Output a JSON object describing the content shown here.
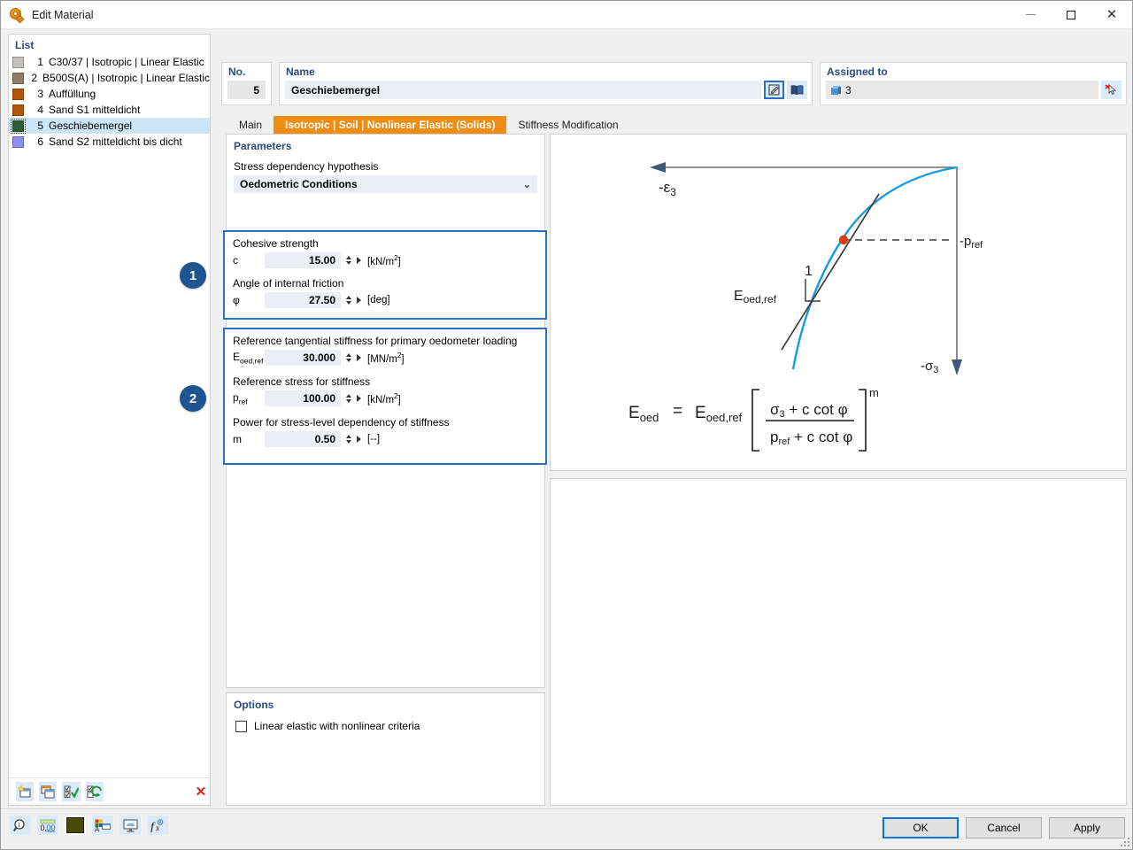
{
  "window": {
    "title": "Edit Material",
    "icon": "material-icon",
    "minimize": "–",
    "maximize": "□",
    "close": "✕"
  },
  "list": {
    "title": "List",
    "items": [
      {
        "num": "1",
        "label": "C30/37 | Isotropic | Linear Elastic",
        "color": "#c3c0bd",
        "selected": false
      },
      {
        "num": "2",
        "label": "B500S(A) | Isotropic | Linear Elastic",
        "color": "#8d7e69",
        "selected": false
      },
      {
        "num": "3",
        "label": "Auffüllung",
        "color": "#b2550a",
        "selected": false
      },
      {
        "num": "4",
        "label": "Sand S1 mitteldicht",
        "color": "#b2550a",
        "selected": false
      },
      {
        "num": "5",
        "label": "Geschiebemergel",
        "color": "#2f5c36",
        "selected": true
      },
      {
        "num": "6",
        "label": "Sand S2 mitteldicht bis dicht",
        "color": "#8e8ef0",
        "selected": false
      }
    ],
    "toolbar": [
      {
        "name": "new-material-button",
        "icon": "new-window-icon"
      },
      {
        "name": "copy-material-button",
        "icon": "copy-window-icon"
      },
      {
        "name": "select-all-button",
        "icon": "checked-list-icon"
      },
      {
        "name": "invert-selection-button",
        "icon": "refresh-list-icon"
      },
      {
        "name": "delete-material-button",
        "icon": "red-x-icon",
        "glyph": "✕"
      }
    ]
  },
  "header": {
    "no_label": "No.",
    "no_value": "5",
    "name_label": "Name",
    "name_value": "Geschiebemergel",
    "name_placeholder": "Geschiebemergel",
    "edit_button_icon": "edit-pencil-icon",
    "library_button_icon": "library-book-icon",
    "assigned_label": "Assigned to",
    "assigned_value": "3",
    "assigned_icon": "solid-cube-icon",
    "assigned_pick_icon": "deselect-cursor-icon"
  },
  "tabs": [
    {
      "label": "Main",
      "active": false
    },
    {
      "label": "Isotropic | Soil | Nonlinear Elastic (Solids)",
      "active": true
    },
    {
      "label": "Stiffness Modification",
      "active": false
    }
  ],
  "parameters": {
    "section_title": "Parameters",
    "hypothesis_label": "Stress dependency hypothesis",
    "hypothesis_value": "Oedometric Conditions",
    "hypothesis_chevron": "chevron-down-icon"
  },
  "group1": {
    "badge": "1",
    "cohesive_label": "Cohesive strength",
    "c_symbol": "c",
    "c_value": "15.00",
    "c_unit": "[kN/m2]",
    "friction_label": "Angle of internal friction",
    "phi_symbol": "φ",
    "phi_value": "27.50",
    "phi_unit": "[deg]"
  },
  "group2": {
    "badge": "2",
    "eoed_label": "Reference tangential stiffness for primary oedometer loading",
    "eoed_symbol": "Eoed,ref",
    "eoed_value": "30.000",
    "eoed_unit": "[MN/m2]",
    "pref_label": "Reference stress for stiffness",
    "pref_symbol": "pref",
    "pref_value": "100.00",
    "pref_unit": "[kN/m2]",
    "m_label": "Power for stress-level dependency of stiffness",
    "m_symbol": "m",
    "m_value": "0.50",
    "m_unit": "[--]"
  },
  "options": {
    "section_title": "Options",
    "checkbox_label": "Linear elastic with nonlinear criteria",
    "checkbox_checked": false
  },
  "diagram": {
    "axis_strain": "-ε3",
    "axis_stress": "-σ3",
    "pref_label": "-pref",
    "slope_label": "Eoed,ref",
    "slope_one": "1",
    "formula": "Eoed = Eoed,ref [ (σ3 + c cot φ) / (pref + c cot φ) ] m",
    "curve_color": "#1b9ae0",
    "tangent_color": "#3b3b3b",
    "point_color": "#d93b0b",
    "axis_color": "#6f6f6f"
  },
  "bottom_toolbar": [
    {
      "name": "info-magnifier-button",
      "icon": "magnifier-icon"
    },
    {
      "name": "numeric-format-button",
      "icon": "number-format-icon"
    },
    {
      "name": "color-swatch-button",
      "icon": "color-swatch-icon",
      "color": "#4a4a08"
    },
    {
      "name": "legend-settings-button",
      "icon": "legend-icon"
    },
    {
      "name": "display-settings-button",
      "icon": "monitor-icon"
    },
    {
      "name": "function-button",
      "icon": "function-icon"
    }
  ],
  "dialog_buttons": {
    "ok": "OK",
    "cancel": "Cancel",
    "apply": "Apply"
  }
}
